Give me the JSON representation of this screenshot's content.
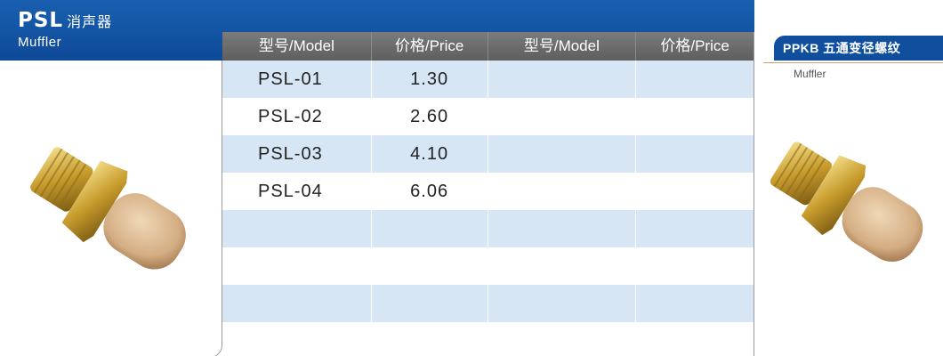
{
  "header": {
    "code": "PSL",
    "name_cn": "消声器",
    "name_en": "Muffler"
  },
  "table": {
    "headers": [
      "型号/Model",
      "价格/Price",
      "型号/Model",
      "价格/Price"
    ],
    "rows": [
      [
        "PSL-01",
        "1.30",
        "",
        ""
      ],
      [
        "PSL-02",
        "2.60",
        "",
        ""
      ],
      [
        "PSL-03",
        "4.10",
        "",
        ""
      ],
      [
        "PSL-04",
        "6.06",
        "",
        ""
      ],
      [
        "",
        "",
        "",
        ""
      ],
      [
        "",
        "",
        "",
        ""
      ],
      [
        "",
        "",
        "",
        ""
      ]
    ]
  },
  "side": {
    "title": "PPKB 五通变径螺纹",
    "subtitle": "Muffler"
  },
  "colors": {
    "header_blue": "#0d4a98",
    "row_shade": "#d6e6f4",
    "table_head_gray": "#6b6b6b",
    "brass": "#c9a437",
    "sintered_bronze": "#d8b48a"
  },
  "images": [
    "brass-muffler-photo",
    "brass-muffler-photo"
  ]
}
